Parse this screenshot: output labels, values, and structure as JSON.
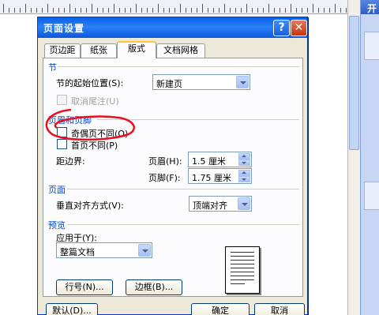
{
  "colors": {
    "title_bar": "#0a5fe6",
    "section_label": "#0046d5",
    "annotation": "#e8101e",
    "active_tab": "#ffc83c"
  },
  "dialog": {
    "title": "页面设置",
    "help_icon": "?",
    "close_icon": "✕",
    "tabs": [
      {
        "label": "页边距"
      },
      {
        "label": "纸张"
      },
      {
        "label": "版式",
        "active": true
      },
      {
        "label": "文档网格"
      }
    ]
  },
  "section": {
    "title": "节",
    "start_label": "节的起始位置(S):",
    "start_value": "新建页",
    "suppress_endnotes": "取消尾注(U)"
  },
  "header_footer": {
    "title": "页眉和页脚",
    "odd_even": "奇偶页不同(O)",
    "first_page": "首页不同(P)",
    "from_edge_label": "距边界:",
    "header_label": "页眉(H):",
    "header_value": "1.5 厘米",
    "footer_label": "页脚(F):",
    "footer_value": "1.75 厘米"
  },
  "page": {
    "title": "页面",
    "vertical_align_label": "垂直对齐方式(V):",
    "vertical_align_value": "顶端对齐"
  },
  "preview": {
    "title": "预览",
    "apply_to_label": "应用于(Y):",
    "apply_to_value": "整篇文档"
  },
  "buttons": {
    "line_numbers": "行号(N)...",
    "borders": "边框(B)...",
    "default": "默认(D)...",
    "ok": "确定",
    "cancel": "取消"
  },
  "side_pane": {
    "title_char": "开"
  }
}
